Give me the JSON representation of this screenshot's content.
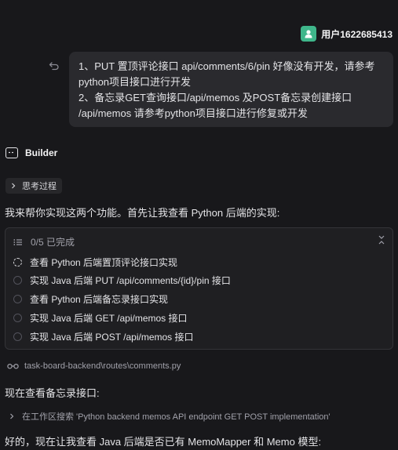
{
  "user": {
    "name": "用户1622685413"
  },
  "message": {
    "lines": [
      "1、PUT 置顶评论接口 api/comments/6/pin 好像没有开发，请参考",
      "python项目接口进行开发",
      "2、备忘录GET查询接口/api/memos 及POST备忘录创建接口",
      "/api/memos 请参考python项目接口进行修复或开发"
    ]
  },
  "assistant": {
    "name": "Builder",
    "thinking_label": "思考过程",
    "intro": "我来帮你实现这两个功能。首先让我查看 Python 后端的实现:",
    "tasks": {
      "progress": "0/5 已完成",
      "items": [
        {
          "label": "查看 Python 后端置顶评论接口实现",
          "status": "in-progress"
        },
        {
          "label": "实现 Java 后端 PUT /api/comments/{id}/pin 接口",
          "status": "pending"
        },
        {
          "label": "查看 Python 后端备忘录接口实现",
          "status": "pending"
        },
        {
          "label": "实现 Java 后端 GET /api/memos 接口",
          "status": "pending"
        },
        {
          "label": "实现 Java 后端 POST /api/memos 接口",
          "status": "pending"
        }
      ]
    },
    "file_ref": "task-board-backend\\routes\\comments.py",
    "followup": "现在查看备忘录接口:",
    "search": "在工作区搜索 'Python backend memos API endpoint GET POST implementation'",
    "next": "好的，现在让我查看 Java 后端是否已有 MemoMapper 和 Memo 模型:"
  }
}
